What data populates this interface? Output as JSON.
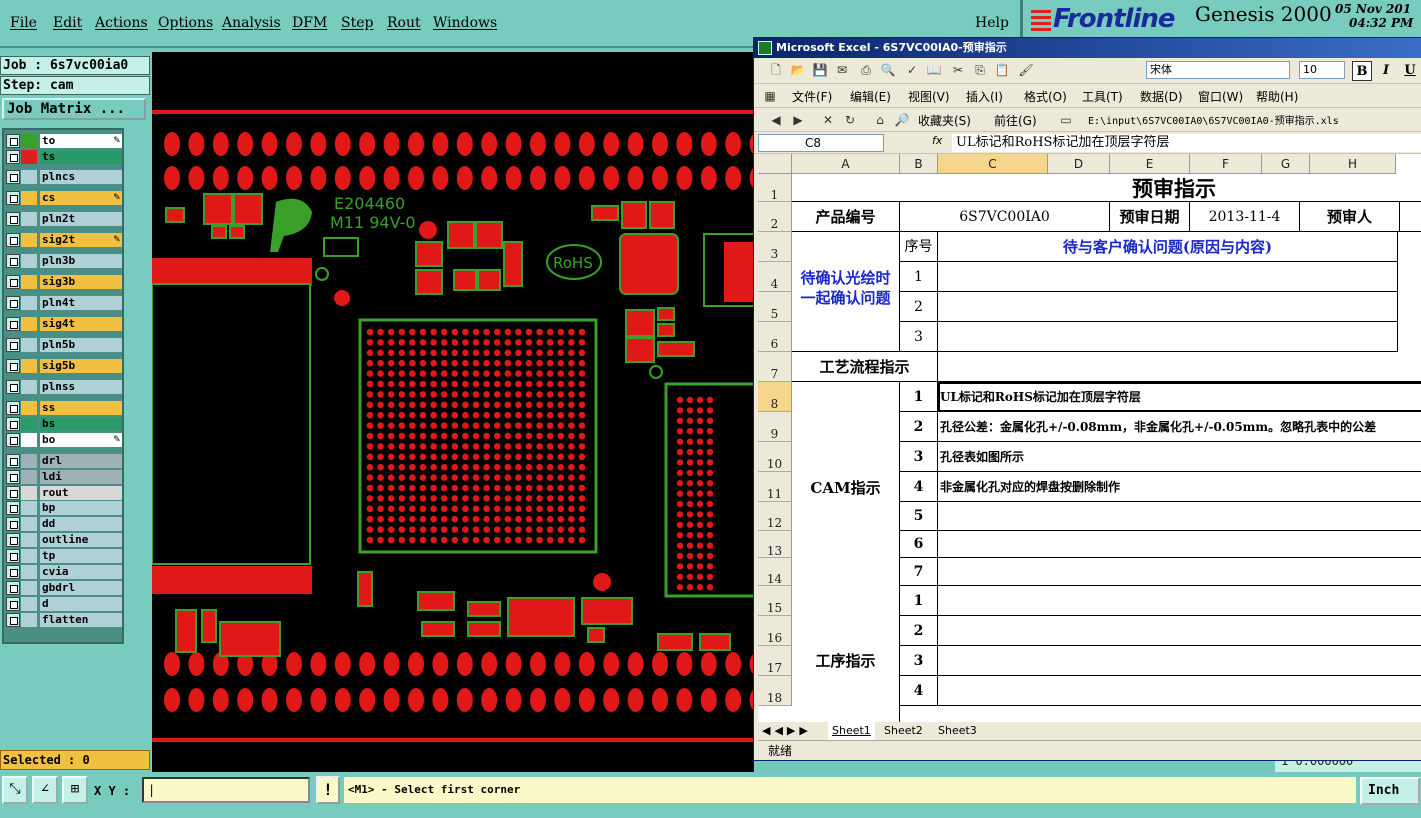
{
  "menu": {
    "items": [
      "File",
      "Edit",
      "Actions",
      "Options",
      "Analysis",
      "DFM",
      "Step",
      "Rout",
      "Windows"
    ],
    "help": "Help"
  },
  "brand": {
    "logo": "Frontline",
    "product": "Genesis 2000",
    "date": "05 Nov 201",
    "time": "04:32 PM"
  },
  "job": {
    "job_label": "Job : 6s7vc00ia0",
    "step_label": "Step: cam",
    "matrix_button": "Job Matrix ..."
  },
  "layers": [
    {
      "name": "to",
      "color": "#ffffff",
      "swatch": "#3aa02a",
      "edit": true
    },
    {
      "name": "ts",
      "color": "#2a9a6a",
      "swatch": "#e02020",
      "edit": false
    },
    {
      "name": "plncs",
      "color": "#b0d0d8",
      "swatch": "#b0d0d8",
      "edit": false
    },
    {
      "name": "cs",
      "color": "#f2c040",
      "swatch": "#f2c040",
      "edit": true
    },
    {
      "name": "pln2t",
      "color": "#b0d0d8",
      "swatch": "#b0d0d8",
      "edit": false
    },
    {
      "name": "sig2t",
      "color": "#f2c040",
      "swatch": "#f2c040",
      "edit": true
    },
    {
      "name": "pln3b",
      "color": "#b0d0d8",
      "swatch": "#b0d0d8",
      "edit": false
    },
    {
      "name": "sig3b",
      "color": "#f2c040",
      "swatch": "#f2c040",
      "edit": false
    },
    {
      "name": "pln4t",
      "color": "#b0d0d8",
      "swatch": "#b0d0d8",
      "edit": false
    },
    {
      "name": "sig4t",
      "color": "#f2c040",
      "swatch": "#f2c040",
      "edit": false
    },
    {
      "name": "pln5b",
      "color": "#b0d0d8",
      "swatch": "#b0d0d8",
      "edit": false
    },
    {
      "name": "sig5b",
      "color": "#f2c040",
      "swatch": "#f2c040",
      "edit": false
    },
    {
      "name": "plnss",
      "color": "#b0d0d8",
      "swatch": "#b0d0d8",
      "edit": false
    },
    {
      "name": "ss",
      "color": "#f2c040",
      "swatch": "#f2c040",
      "edit": false
    },
    {
      "name": "bs",
      "color": "#2a9a6a",
      "swatch": "#2a9a6a",
      "edit": false
    },
    {
      "name": "bo",
      "color": "#ffffff",
      "swatch": "#ffffff",
      "edit": true
    },
    {
      "name": "drl",
      "color": "#a0b0b8",
      "swatch": "#a0b0b8",
      "edit": false
    },
    {
      "name": "ldi",
      "color": "#a0b0b8",
      "swatch": "#a0b0b8",
      "edit": false
    },
    {
      "name": "rout",
      "color": "#d8d8d8",
      "swatch": "#d8d8d8",
      "edit": false
    },
    {
      "name": "bp",
      "color": "#b0d0d8",
      "swatch": "#b0d0d8",
      "edit": false
    },
    {
      "name": "dd",
      "color": "#b0d0d8",
      "swatch": "#b0d0d8",
      "edit": false
    },
    {
      "name": "outline",
      "color": "#b0d0d8",
      "swatch": "#b0d0d8",
      "edit": false
    },
    {
      "name": "tp",
      "color": "#b0d0d8",
      "swatch": "#b0d0d8",
      "edit": false
    },
    {
      "name": "cvia",
      "color": "#b0d0d8",
      "swatch": "#b0d0d8",
      "edit": false
    },
    {
      "name": "gbdrl",
      "color": "#b0d0d8",
      "swatch": "#b0d0d8",
      "edit": false
    },
    {
      "name": "d",
      "color": "#b0d0d8",
      "swatch": "#b0d0d8",
      "edit": false
    },
    {
      "name": "flatten",
      "color": "#b0d0d8",
      "swatch": "#b0d0d8",
      "edit": false
    }
  ],
  "status": {
    "selected": "Selected : 0",
    "xy_label": "X Y :",
    "prompt": "<M1> - Select first corner",
    "unit": "Inch",
    "readout": "1    0.000000"
  },
  "pcb": {
    "marking_code": "E204460",
    "marking_grade": "M11 94V-0",
    "rohs": "RoHS"
  },
  "excel": {
    "title": "Microsoft Excel - 6S7VC00IA0-预审指示",
    "menus": [
      "文件(F)",
      "编辑(E)",
      "视图(V)",
      "插入(I)",
      "格式(O)",
      "工具(T)",
      "数据(D)",
      "窗口(W)",
      "帮助(H)"
    ],
    "font_name": "宋体",
    "font_size": "10",
    "favorites": "收藏夹(S)",
    "goto": "前往(G)",
    "address": "E:\\input\\6S7VC00IA0\\6S7VC00IA0-预审指示.xls",
    "name_box": "C8",
    "formula": "UL标记和RoHS标记加在顶层字符层",
    "columns": [
      "A",
      "B",
      "C",
      "D",
      "E",
      "F",
      "G",
      "H"
    ],
    "title_cell": "预审指示",
    "row2": {
      "product_label": "产品编号",
      "product_no": "6S7VC00IA0",
      "date_label": "预审日期",
      "date": "2013-11-4",
      "reviewer_label": "预审人"
    },
    "confirm_label": "待确认光绘时一起确认问题",
    "seq_label": "序号",
    "issue_header": "待与客户确认问题(原因与内容)",
    "process_label": "工艺流程指示",
    "cam_label": "CAM指示",
    "cam_items": [
      "UL标记和RoHS标记加在顶层字符层",
      "孔径公差：金属化孔+/-0.08mm，非金属化孔+/-0.05mm。忽略孔表中的公差",
      "孔径表如图所示",
      "非金属化孔对应的焊盘按删除制作",
      "",
      "",
      ""
    ],
    "procedure_label": "工序指示",
    "sheets": [
      "Sheet1",
      "Sheet2",
      "Sheet3"
    ],
    "ready": "就绪"
  }
}
